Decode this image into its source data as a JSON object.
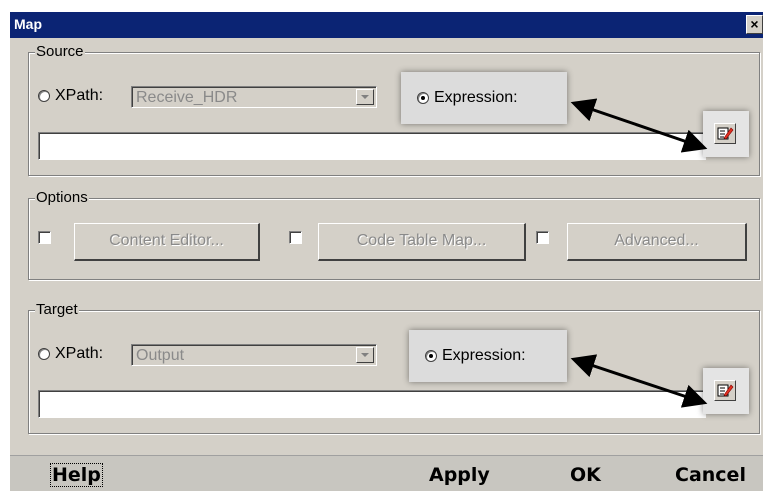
{
  "window": {
    "title": "Map",
    "close_label": "×"
  },
  "source": {
    "legend": "Source",
    "xpath_label": "XPath:",
    "xpath_value": "Receive_HDR",
    "expression_label": "Expression:",
    "expression_value": ""
  },
  "options": {
    "legend": "Options",
    "content_editor_label": "Content Editor...",
    "code_table_map_label": "Code Table Map...",
    "advanced_label": "Advanced..."
  },
  "target": {
    "legend": "Target",
    "xpath_label": "XPath:",
    "xpath_value": "Output",
    "expression_label": "Expression:",
    "expression_value": ""
  },
  "footer": {
    "help_label": "Help",
    "apply_label": "Apply",
    "ok_label": "OK",
    "cancel_label": "Cancel"
  },
  "colors": {
    "titlebar": "#0b2474",
    "dialog_bg": "#d4d0c8"
  },
  "icons": [
    "close-icon",
    "edit-expression-icon",
    "callout-arrow"
  ]
}
